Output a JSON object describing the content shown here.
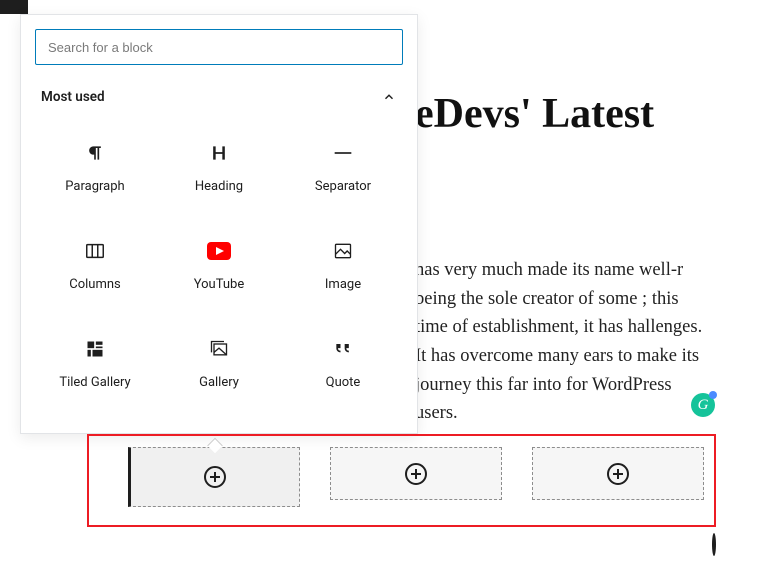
{
  "heading": "eDevs' Latest",
  "body_text": "has very much made its name well-r being the sole creator of some ; this time of establishment, it has hallenges. It has overcome many ears to make its journey this far into for WordPress users.",
  "grammarly_label": "G",
  "search": {
    "placeholder": "Search for a block"
  },
  "section": {
    "title": "Most used"
  },
  "blocks": [
    {
      "label": "Paragraph",
      "icon": "paragraph"
    },
    {
      "label": "Heading",
      "icon": "heading"
    },
    {
      "label": "Separator",
      "icon": "separator"
    },
    {
      "label": "Columns",
      "icon": "columns"
    },
    {
      "label": "YouTube",
      "icon": "youtube"
    },
    {
      "label": "Image",
      "icon": "image"
    },
    {
      "label": "Tiled Gallery",
      "icon": "tiled-gallery"
    },
    {
      "label": "Gallery",
      "icon": "gallery"
    },
    {
      "label": "Quote",
      "icon": "quote"
    }
  ]
}
